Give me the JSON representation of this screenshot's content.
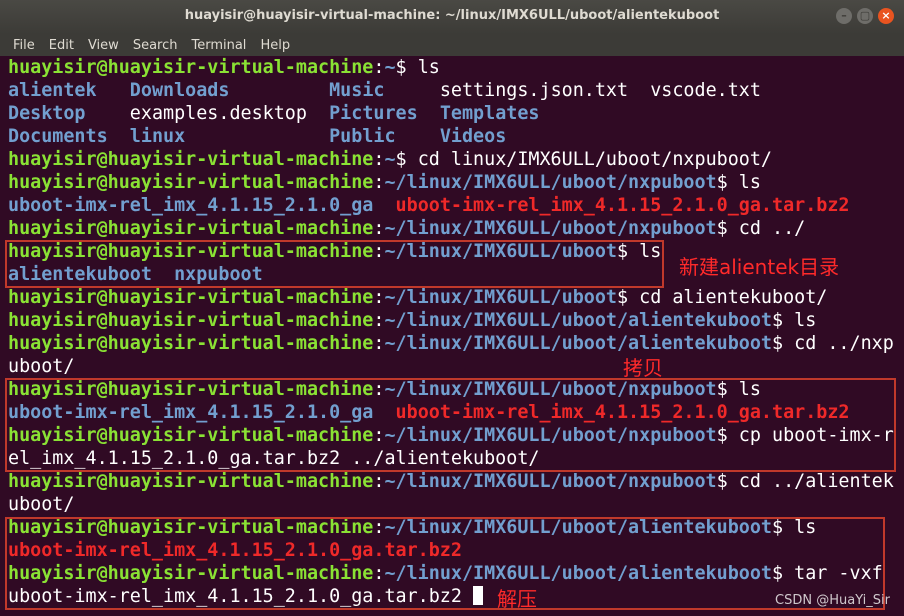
{
  "window": {
    "title": "huayisir@huayisir-virtual-machine: ~/linux/IMX6ULL/uboot/alientekuboot",
    "minimize": "–",
    "maximize": "▢",
    "close": "×"
  },
  "menu": [
    "File",
    "Edit",
    "View",
    "Search",
    "Terminal",
    "Help"
  ],
  "prompt": {
    "user": "huayisir@huayisir-virtual-machine"
  },
  "lines": [
    [
      {
        "t": "huayisir@huayisir-virtual-machine",
        "c": "g"
      },
      {
        "t": ":",
        "c": "w"
      },
      {
        "t": "~",
        "c": "b"
      },
      {
        "t": "$ ls",
        "c": "w"
      }
    ],
    [
      {
        "t": "alientek   ",
        "c": "b"
      },
      {
        "t": "Downloads         ",
        "c": "b"
      },
      {
        "t": "Music     ",
        "c": "b"
      },
      {
        "t": "settings.json.txt  vscode.txt",
        "c": "w"
      }
    ],
    [
      {
        "t": "Desktop    ",
        "c": "b"
      },
      {
        "t": "examples.desktop  ",
        "c": "w"
      },
      {
        "t": "Pictures  ",
        "c": "b"
      },
      {
        "t": "Templates",
        "c": "b"
      }
    ],
    [
      {
        "t": "Documents  ",
        "c": "b"
      },
      {
        "t": "linux             ",
        "c": "b"
      },
      {
        "t": "Public    ",
        "c": "b"
      },
      {
        "t": "Videos",
        "c": "b"
      }
    ],
    [
      {
        "t": "huayisir@huayisir-virtual-machine",
        "c": "g"
      },
      {
        "t": ":",
        "c": "w"
      },
      {
        "t": "~",
        "c": "b"
      },
      {
        "t": "$ cd linux/IMX6ULL/uboot/nxpuboot/",
        "c": "w"
      }
    ],
    [
      {
        "t": "huayisir@huayisir-virtual-machine",
        "c": "g"
      },
      {
        "t": ":",
        "c": "w"
      },
      {
        "t": "~/linux/IMX6ULL/uboot/nxpuboot",
        "c": "b"
      },
      {
        "t": "$ ls",
        "c": "w"
      }
    ],
    [
      {
        "t": "uboot-imx-rel_imx_4.1.15_2.1.0_ga",
        "c": "b"
      },
      {
        "t": "  ",
        "c": "w"
      },
      {
        "t": "uboot-imx-rel_imx_4.1.15_2.1.0_ga.tar.bz2",
        "c": "r"
      }
    ],
    [
      {
        "t": "huayisir@huayisir-virtual-machine",
        "c": "g"
      },
      {
        "t": ":",
        "c": "w"
      },
      {
        "t": "~/linux/IMX6ULL/uboot/nxpuboot",
        "c": "b"
      },
      {
        "t": "$ cd ../",
        "c": "w"
      }
    ],
    [
      {
        "t": "huayisir@huayisir-virtual-machine",
        "c": "g"
      },
      {
        "t": ":",
        "c": "w"
      },
      {
        "t": "~/linux/IMX6ULL/uboot",
        "c": "b"
      },
      {
        "t": "$ ls",
        "c": "w"
      }
    ],
    [
      {
        "t": "alientekuboot  nxpuboot",
        "c": "b"
      }
    ],
    [
      {
        "t": "huayisir@huayisir-virtual-machine",
        "c": "g"
      },
      {
        "t": ":",
        "c": "w"
      },
      {
        "t": "~/linux/IMX6ULL/uboot",
        "c": "b"
      },
      {
        "t": "$ cd alientekuboot/",
        "c": "w"
      }
    ],
    [
      {
        "t": "huayisir@huayisir-virtual-machine",
        "c": "g"
      },
      {
        "t": ":",
        "c": "w"
      },
      {
        "t": "~/linux/IMX6ULL/uboot/alientekuboot",
        "c": "b"
      },
      {
        "t": "$ ls",
        "c": "w"
      }
    ],
    [
      {
        "t": "huayisir@huayisir-virtual-machine",
        "c": "g"
      },
      {
        "t": ":",
        "c": "w"
      },
      {
        "t": "~/linux/IMX6ULL/uboot/alientekuboot",
        "c": "b"
      },
      {
        "t": "$ cd ../nxp",
        "c": "w"
      }
    ],
    [
      {
        "t": "uboot/",
        "c": "w"
      }
    ],
    [
      {
        "t": "huayisir@huayisir-virtual-machine",
        "c": "g"
      },
      {
        "t": ":",
        "c": "w"
      },
      {
        "t": "~/linux/IMX6ULL/uboot/nxpuboot",
        "c": "b"
      },
      {
        "t": "$ ls",
        "c": "w"
      }
    ],
    [
      {
        "t": "uboot-imx-rel_imx_4.1.15_2.1.0_ga",
        "c": "b"
      },
      {
        "t": "  ",
        "c": "w"
      },
      {
        "t": "uboot-imx-rel_imx_4.1.15_2.1.0_ga.tar.bz2",
        "c": "r"
      }
    ],
    [
      {
        "t": "huayisir@huayisir-virtual-machine",
        "c": "g"
      },
      {
        "t": ":",
        "c": "w"
      },
      {
        "t": "~/linux/IMX6ULL/uboot/nxpuboot",
        "c": "b"
      },
      {
        "t": "$ cp uboot-imx-r",
        "c": "w"
      }
    ],
    [
      {
        "t": "el_imx_4.1.15_2.1.0_ga.tar.bz2 ../alientekuboot/",
        "c": "w"
      }
    ],
    [
      {
        "t": "huayisir@huayisir-virtual-machine",
        "c": "g"
      },
      {
        "t": ":",
        "c": "w"
      },
      {
        "t": "~/linux/IMX6ULL/uboot/nxpuboot",
        "c": "b"
      },
      {
        "t": "$ cd ../alientek",
        "c": "w"
      }
    ],
    [
      {
        "t": "uboot/",
        "c": "w"
      }
    ],
    [
      {
        "t": "huayisir@huayisir-virtual-machine",
        "c": "g"
      },
      {
        "t": ":",
        "c": "w"
      },
      {
        "t": "~/linux/IMX6ULL/uboot/alientekuboot",
        "c": "b"
      },
      {
        "t": "$ ls",
        "c": "w"
      }
    ],
    [
      {
        "t": "uboot-imx-rel_imx_4.1.15_2.1.0_ga.tar.bz2",
        "c": "r"
      }
    ],
    [
      {
        "t": "huayisir@huayisir-virtual-machine",
        "c": "g"
      },
      {
        "t": ":",
        "c": "w"
      },
      {
        "t": "~/linux/IMX6ULL/uboot/alientekuboot",
        "c": "b"
      },
      {
        "t": "$ tar -vxf",
        "c": "w"
      }
    ],
    [
      {
        "t": "uboot-imx-rel_imx_4.1.15_2.1.0_ga.tar.bz2 ",
        "c": "w"
      }
    ]
  ],
  "annotations": {
    "new_dir": "新建alientek目录",
    "copy": "拷贝",
    "extract": "解压"
  },
  "colors": {
    "prompt_user": "#8ae234",
    "path": "#729fcf",
    "archive": "#ef2929",
    "annotation": "#ff2a2a",
    "background": "#300a24"
  },
  "watermark": "CSDN @HuaYi_Sir"
}
